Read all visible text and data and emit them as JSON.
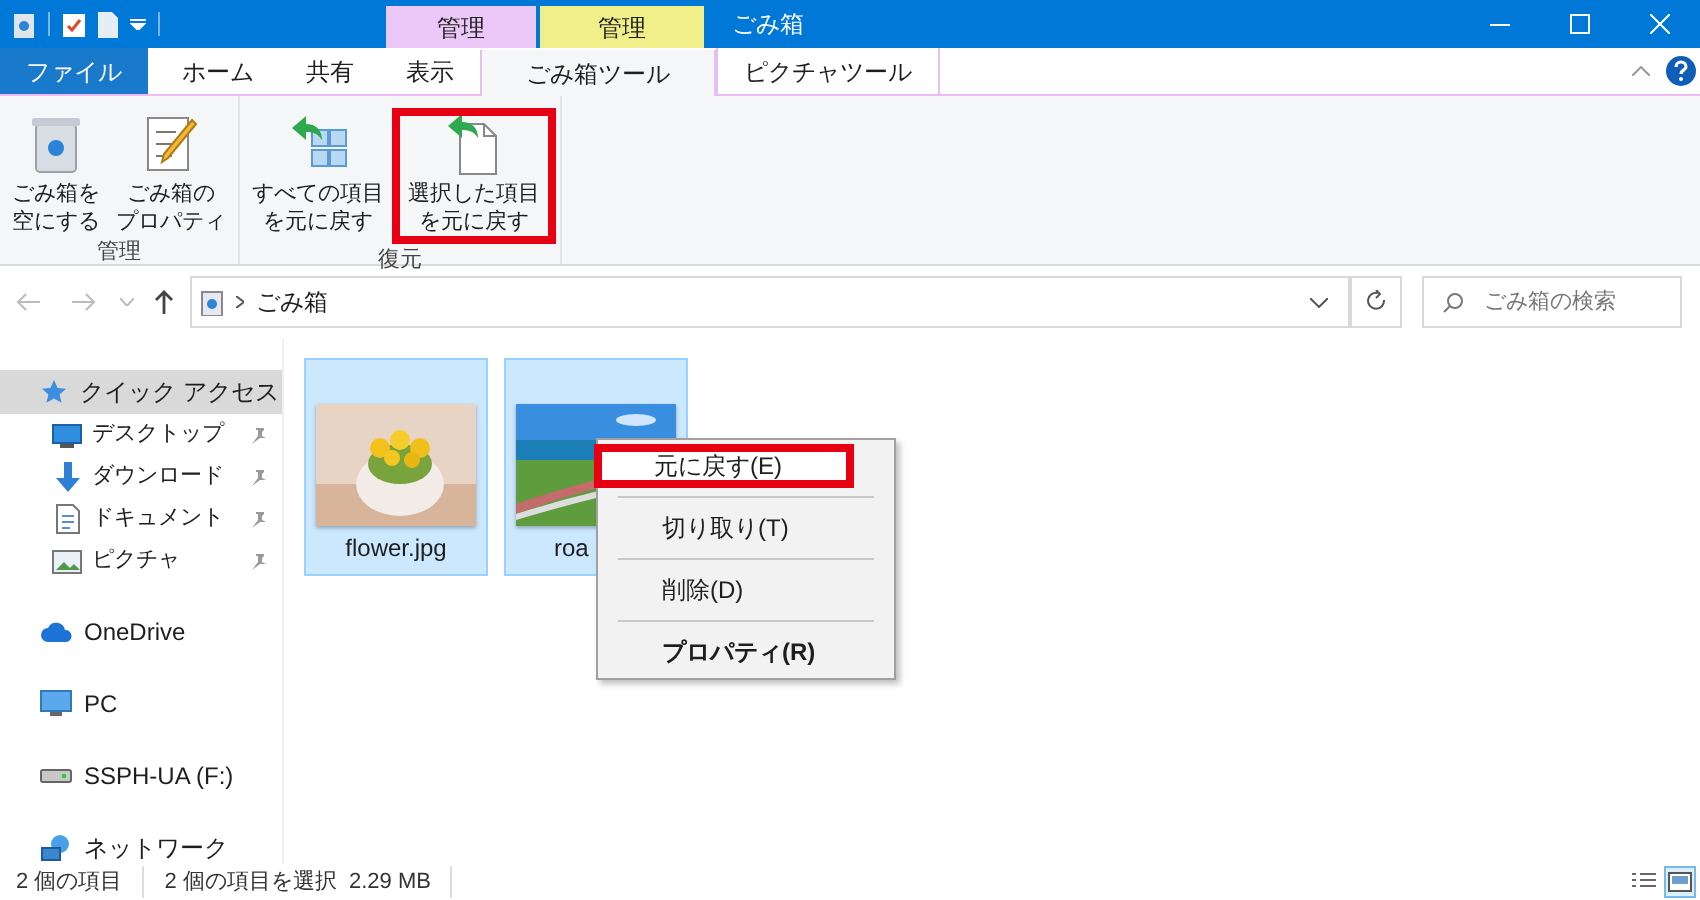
{
  "window": {
    "title": "ごみ箱"
  },
  "context_tab_groups": [
    {
      "label": "管理",
      "color": "#ecc8f8"
    },
    {
      "label": "管理",
      "color": "#f1ef8a"
    }
  ],
  "ribbon_tabs": [
    {
      "label": "ファイル",
      "kind": "file",
      "selected": false
    },
    {
      "label": "ホーム",
      "kind": "tab",
      "selected": false
    },
    {
      "label": "共有",
      "kind": "tab",
      "selected": false
    },
    {
      "label": "表示",
      "kind": "tab",
      "selected": false
    },
    {
      "label": "ごみ箱ツール",
      "kind": "context",
      "selected": true
    },
    {
      "label": "ピクチャツール",
      "kind": "context",
      "selected": false
    }
  ],
  "ribbon_groups": [
    {
      "label": "管理",
      "buttons": [
        {
          "lines": [
            "ごみ箱を",
            "空にする"
          ],
          "kind": "empty",
          "highlighted": false
        },
        {
          "lines": [
            "ごみ箱の",
            "プロパティ"
          ],
          "kind": "properties",
          "highlighted": false
        }
      ]
    },
    {
      "label": "復元",
      "buttons": [
        {
          "lines": [
            "すべての項目",
            "を元に戻す"
          ],
          "kind": "restore-all",
          "highlighted": false
        },
        {
          "lines": [
            "選択した項目",
            "を元に戻す"
          ],
          "kind": "restore-selected",
          "highlighted": true
        }
      ]
    }
  ],
  "address": {
    "path": "ごみ箱"
  },
  "search": {
    "placeholder": "ごみ箱の検索"
  },
  "nav": [
    {
      "label": "クイック アクセス",
      "kind": "quick",
      "selected": true,
      "children": [
        {
          "label": "デスクトップ",
          "kind": "desktop",
          "pinned": true
        },
        {
          "label": "ダウンロード",
          "kind": "download",
          "pinned": true
        },
        {
          "label": "ドキュメント",
          "kind": "documents",
          "pinned": true
        },
        {
          "label": "ピクチャ",
          "kind": "pictures",
          "pinned": true
        }
      ]
    },
    {
      "label": "OneDrive",
      "kind": "onedrive",
      "selected": false
    },
    {
      "label": "PC",
      "kind": "pc",
      "selected": false
    },
    {
      "label": "SSPH-UA (F:)",
      "kind": "drive",
      "selected": false
    },
    {
      "label": "ネットワーク",
      "kind": "network",
      "selected": false
    }
  ],
  "files": [
    {
      "name": "flower.jpg",
      "kind": "picture",
      "selected": true
    },
    {
      "name": "roa",
      "kind": "picture",
      "selected": true
    }
  ],
  "context_menu": {
    "items": [
      {
        "label": "元に戻す(E)",
        "kind": "item",
        "bold": false,
        "highlighted": true
      },
      {
        "kind": "separator"
      },
      {
        "label": "切り取り(T)",
        "kind": "item",
        "bold": false,
        "highlighted": false
      },
      {
        "kind": "separator"
      },
      {
        "label": "削除(D)",
        "kind": "item",
        "bold": false,
        "highlighted": false
      },
      {
        "kind": "separator"
      },
      {
        "label": "プロパティ(R)",
        "kind": "item",
        "bold": true,
        "highlighted": false
      }
    ]
  },
  "status_bar": {
    "count": "2 個の項目",
    "selection": "2 個の項目を選択  2.29 MB",
    "views": [
      {
        "kind": "details",
        "selected": false
      },
      {
        "kind": "large",
        "selected": true
      }
    ]
  }
}
